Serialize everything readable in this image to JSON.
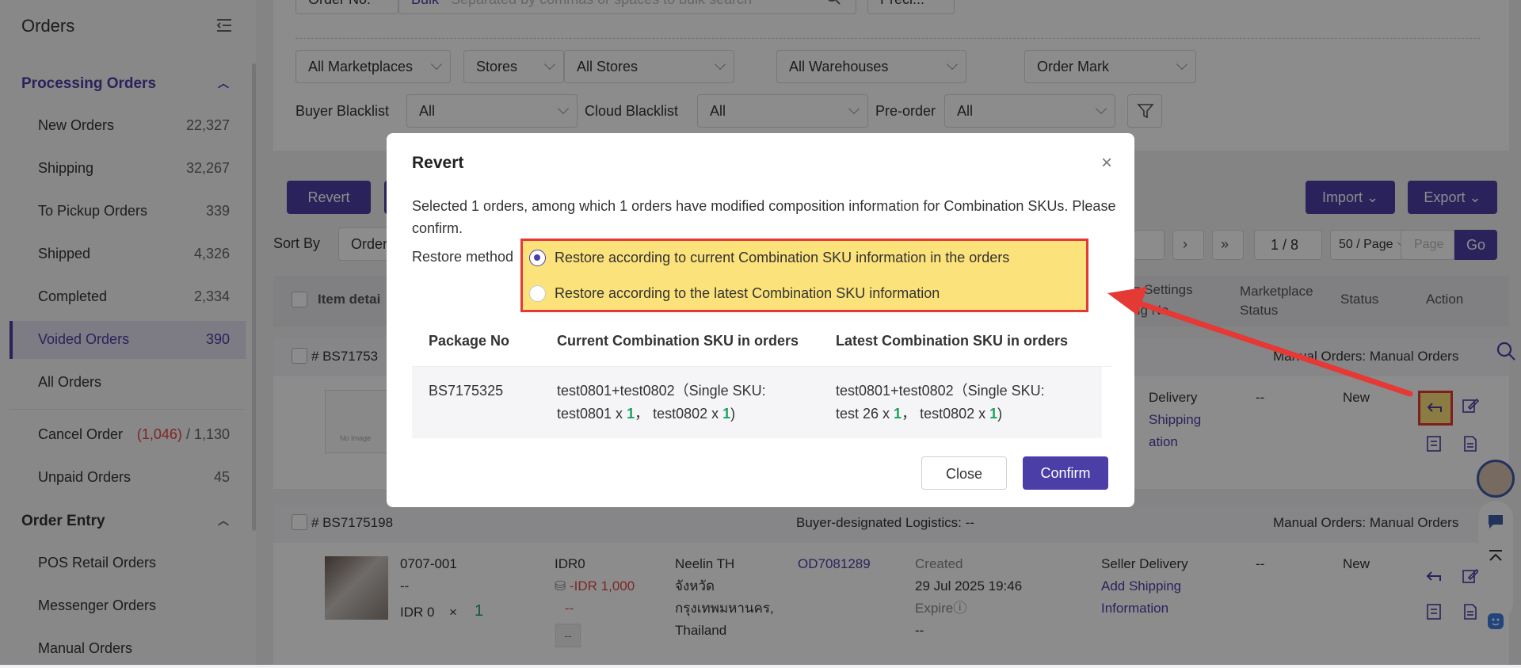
{
  "sidebar": {
    "title": "Orders",
    "sections": {
      "processing": "Processing Orders",
      "entry": "Order Entry"
    },
    "items": [
      {
        "label": "New Orders",
        "count": "22,327"
      },
      {
        "label": "Shipping",
        "count": "32,267"
      },
      {
        "label": "To Pickup Orders",
        "count": "339"
      },
      {
        "label": "Shipped",
        "count": "4,326"
      },
      {
        "label": "Completed",
        "count": "2,334"
      },
      {
        "label": "Voided Orders",
        "count": "390"
      },
      {
        "label": "All Orders",
        "count": ""
      }
    ],
    "cancel": {
      "label": "Cancel Order",
      "count_red": "(1,046)",
      "count_total": "/ 1,130"
    },
    "unpaid": {
      "label": "Unpaid Orders",
      "count": "45"
    },
    "entry_items": [
      "POS Retail Orders",
      "Messenger Orders",
      "Manual Orders"
    ]
  },
  "filters": {
    "top_partial": {
      "order_no": "Order No.",
      "bulk": "Bulk",
      "bulk_placeholder": "Separated by commas or spaces to bulk search",
      "prec": "Preci..."
    },
    "marketplaces": "All Marketplaces",
    "stores_label": "Stores",
    "stores": "All Stores",
    "warehouses": "All Warehouses",
    "order_mark": "Order Mark",
    "buyer_blacklist_label": "Buyer Blacklist",
    "buyer_blacklist": "All",
    "cloud_blacklist_label": "Cloud Blacklist",
    "cloud_blacklist": "All",
    "preorder_label": "Pre-order",
    "preorder": "All"
  },
  "toolbar": {
    "revert": "Revert",
    "import": "Import",
    "export": "Export",
    "sort_by": "Sort By",
    "sort_value": "Order",
    "page_indicator": "1 / 8",
    "page_size": "50 / Page",
    "page_placeholder": "Page",
    "go": "Go"
  },
  "table": {
    "headers": {
      "item": "Item detai",
      "settings": "g Settings",
      "settings2": "ng No.",
      "marketplace_status": "Marketplace Status",
      "status": "Status",
      "action": "Action"
    },
    "row1": {
      "order_no": "# BS71753",
      "source": "Manual Orders: Manual Orders",
      "no_image": "No Image",
      "delivery": "Delivery",
      "shipping_link": "Shipping",
      "info_link": "ation",
      "mstatus": "--",
      "status": "New"
    },
    "row2": {
      "order_no": "# BS7175198",
      "logistics": "Buyer-designated Logistics: --",
      "source": "Manual Orders: Manual Orders",
      "sku": "0707-001",
      "sku_sub": "--",
      "price": "IDR 0",
      "times": "×",
      "qty": "1",
      "idr": "IDR0",
      "neg": "-IDR 1,000",
      "neg_sub": "--",
      "dash_box": "--",
      "addr1": "Neelin TH",
      "addr2": "จังหวัด",
      "addr3": "กรุงเทพมหานคร,",
      "addr4": "Thailand",
      "od": "OD7081289",
      "created_label": "Created",
      "created": "29 Jul 2025 19:46",
      "expire": "Expire",
      "expire_val": "--",
      "seller": "Seller Delivery",
      "add_ship": "Add Shipping",
      "info": "Information",
      "mstatus": "--",
      "status": "New"
    }
  },
  "modal": {
    "title": "Revert",
    "description": "Selected 1 orders, among which 1 orders have modified composition information for Combination SKUs. Please confirm.",
    "restore_label": "Restore method",
    "options": [
      "Restore according to current Combination SKU information in the orders",
      "Restore according to the latest Combination SKU information"
    ],
    "selected_option": 0,
    "table": {
      "headers": [
        "Package No",
        "Current Combination SKU in orders",
        "Latest Combination SKU in orders"
      ],
      "row": {
        "package": "BS7175325",
        "current_line1": "test0801+test0802（Single SKU:",
        "current_a": "test0801 x ",
        "current_a_qty": "1",
        "current_b": "， test0802 x ",
        "current_b_qty": "1",
        "current_end": ")",
        "latest_line1": "test0801+test0802（Single SKU:",
        "latest_a": "test 26 x ",
        "latest_a_qty": "1",
        "latest_b": "， test0802 x ",
        "latest_b_qty": "1",
        "latest_end": ")"
      }
    },
    "close": "Close",
    "confirm": "Confirm"
  },
  "colors": {
    "accent": "#4b3fa7",
    "highlight": "#fbe27a",
    "annotation_red": "#e53935",
    "green": "#1aa260"
  }
}
